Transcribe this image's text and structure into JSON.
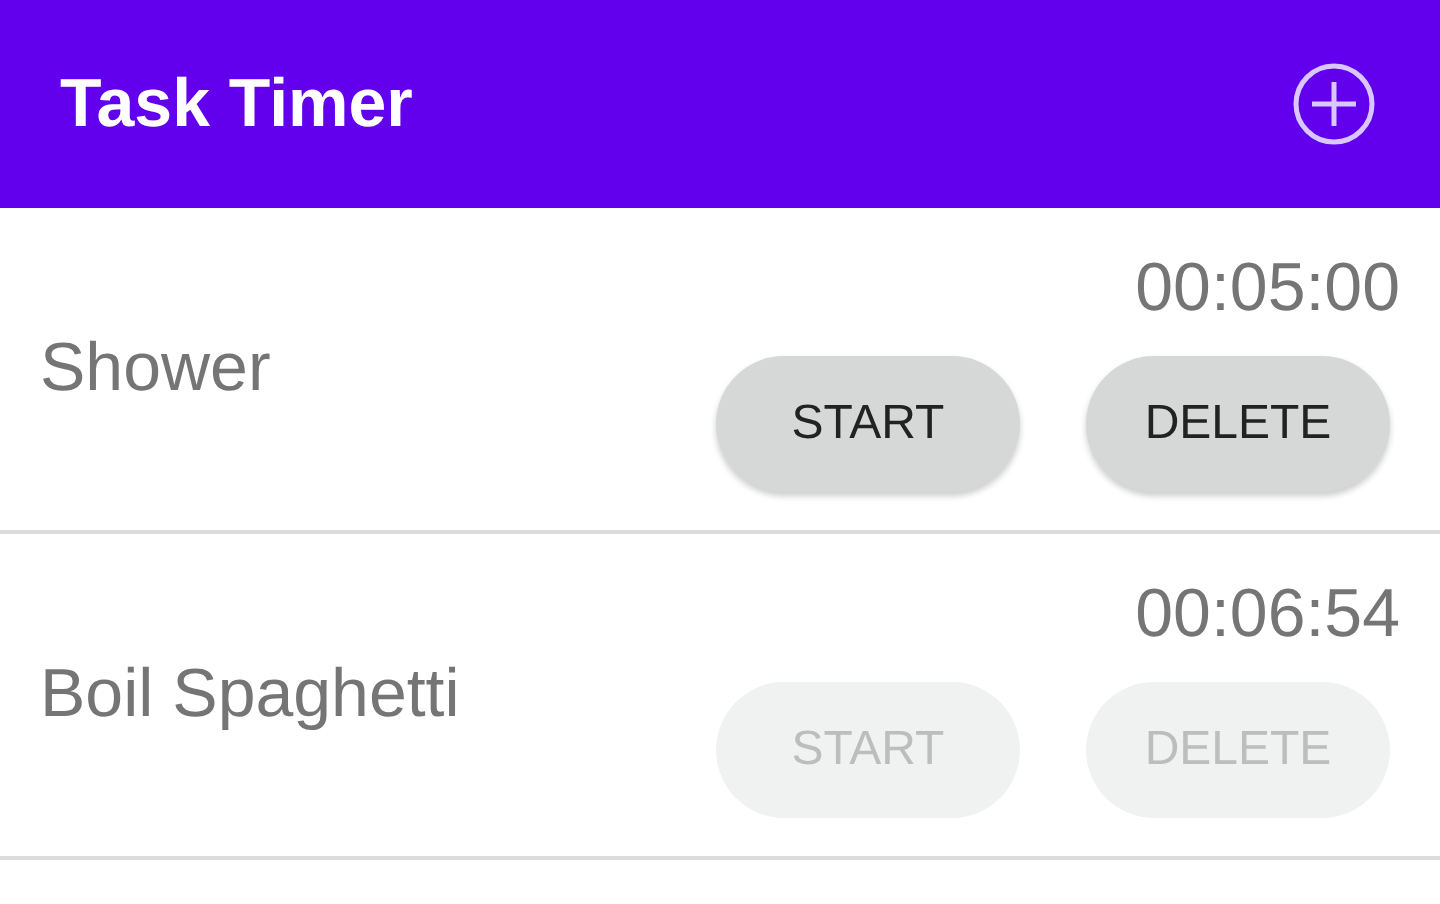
{
  "app_bar": {
    "title": "Task Timer"
  },
  "tasks": [
    {
      "name": "Shower",
      "time": "00:05:00",
      "buttons": [
        {
          "label": "START",
          "disabled": false
        },
        {
          "label": "DELETE",
          "disabled": false
        }
      ]
    },
    {
      "name": "Boil Spaghetti",
      "time": "00:06:54",
      "buttons": [
        {
          "label": "START",
          "disabled": true
        },
        {
          "label": "DELETE",
          "disabled": true
        }
      ]
    }
  ]
}
